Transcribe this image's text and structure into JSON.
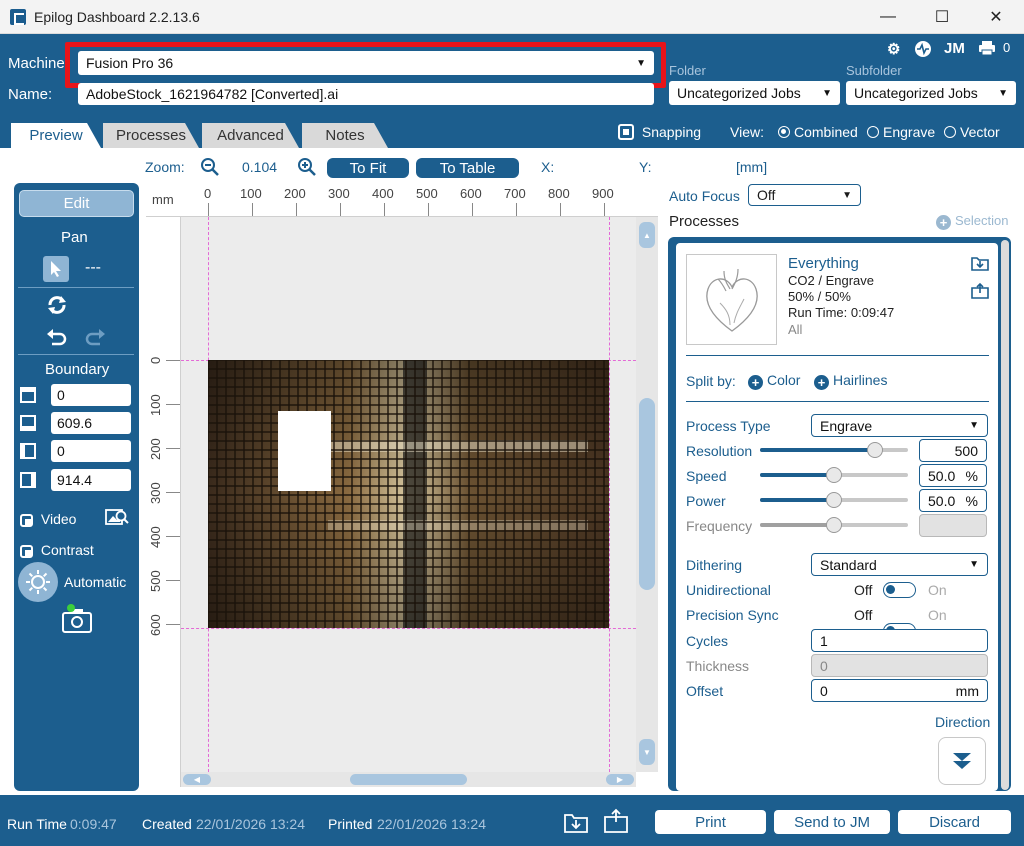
{
  "window": {
    "title": "Epilog Dashboard 2.2.13.6",
    "minimize": "—",
    "maximize": "☐",
    "close": "✕"
  },
  "header": {
    "machine_label": "Machine:",
    "machine_value": "Fusion Pro 36",
    "name_label": "Name:",
    "name_value": "AdobeStock_1621964782 [Converted].ai",
    "folder_label": "Folder",
    "folder_value": "Uncategorized Jobs",
    "subfolder_label": "Subfolder",
    "subfolder_value": "Uncategorized Jobs",
    "jm_label": "JM",
    "queue_count": "0"
  },
  "tabs": [
    {
      "label": "Preview"
    },
    {
      "label": "Processes"
    },
    {
      "label": "Advanced"
    },
    {
      "label": "Notes"
    }
  ],
  "view": {
    "snapping_label": "Snapping",
    "view_label": "View:",
    "options": [
      "Combined",
      "Engrave",
      "Vector"
    ]
  },
  "toolbar": {
    "zoom_label": "Zoom:",
    "zoom_value": "0.104",
    "to_fit": "To Fit",
    "to_table": "To Table",
    "x_label": "X:",
    "y_label": "Y:",
    "units": "[mm]"
  },
  "left_panel": {
    "edit": "Edit",
    "pan": "Pan",
    "dashes": "---",
    "boundary": "Boundary",
    "boundary_values": [
      "0",
      "609.6",
      "0",
      "914.4"
    ],
    "video": "Video",
    "contrast": "Contrast",
    "automatic": "Automatic"
  },
  "canvas": {
    "ruler_unit": "mm",
    "x_ticks": [
      "0",
      "100",
      "200",
      "300",
      "400",
      "500",
      "600",
      "700",
      "800",
      "900"
    ],
    "y_ticks": [
      "0",
      "100",
      "200",
      "300",
      "400",
      "500",
      "600"
    ]
  },
  "right": {
    "auto_focus_label": "Auto Focus",
    "auto_focus_value": "Off",
    "processes_label": "Processes",
    "selection_label": "Selection"
  },
  "process": {
    "name": "Everything",
    "type_line": "CO2 / Engrave",
    "power_speed": "50%  /  50%",
    "run_time": "Run Time: 0:09:47",
    "scope": "All",
    "split_by": "Split by:",
    "split_color": "Color",
    "split_hairlines": "Hairlines",
    "process_type_label": "Process Type",
    "process_type_value": "Engrave",
    "resolution_label": "Resolution",
    "resolution_value": "500",
    "speed_label": "Speed",
    "speed_value": "50.0",
    "power_label": "Power",
    "power_value": "50.0",
    "percent": "%",
    "frequency_label": "Frequency",
    "dithering_label": "Dithering",
    "dithering_value": "Standard",
    "unidirectional_label": "Unidirectional",
    "precision_sync_label": "Precision Sync",
    "off": "Off",
    "on": "On",
    "cycles_label": "Cycles",
    "cycles_value": "1",
    "thickness_label": "Thickness",
    "thickness_value": "0",
    "offset_label": "Offset",
    "offset_value": "0",
    "offset_unit": "mm",
    "direction_label": "Direction",
    "resolution_level": 0.78,
    "speed_level": 0.5,
    "power_level": 0.5,
    "frequency_level": 0.5
  },
  "status": {
    "run_time_label": "Run Time",
    "run_time_value": "0:09:47",
    "created_label": "Created",
    "created_value": "22/01/2026 13:24",
    "printed_label": "Printed",
    "printed_value": "22/01/2026 13:24",
    "print": "Print",
    "send_to_jm": "Send to JM",
    "discard": "Discard"
  },
  "colors": {
    "brand_blue": "#1c5e8e",
    "highlight_red": "#e8141a"
  }
}
